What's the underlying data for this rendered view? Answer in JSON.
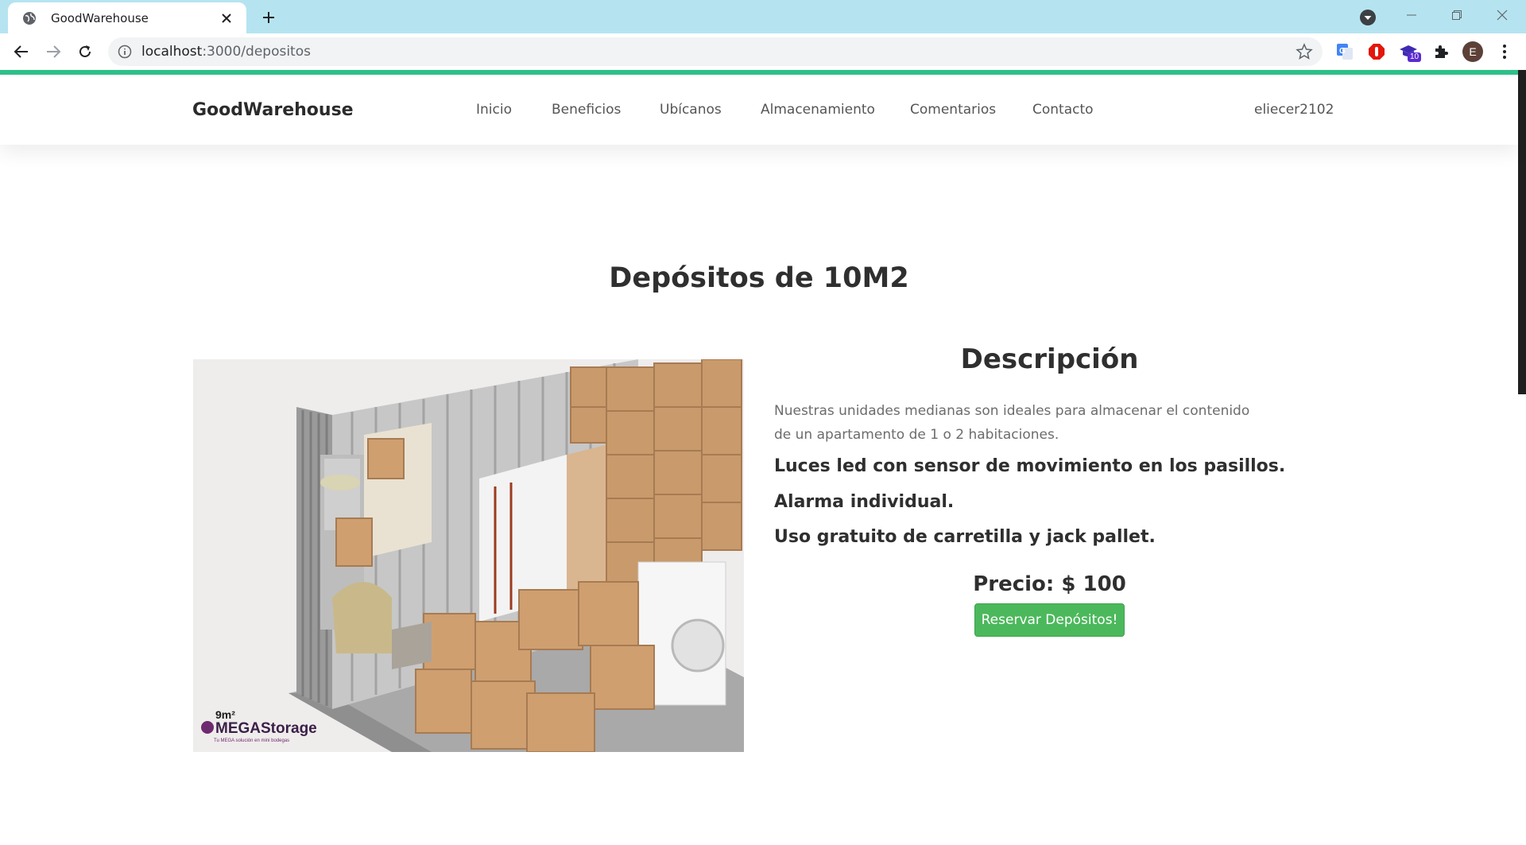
{
  "browser": {
    "tab_title": "GoodWarehouse",
    "url_host": "localhost",
    "url_path": ":3000/depositos",
    "extension_badge": "10",
    "profile_initial": "E"
  },
  "navbar": {
    "brand": "GoodWarehouse",
    "links": [
      "Inicio",
      "Beneficios",
      "Ubícanos",
      "Almacenamiento",
      "Comentarios",
      "Contacto"
    ],
    "user": "eliecer2102"
  },
  "main": {
    "title": "Depósitos de 10M2",
    "image_logo_size": "9m²",
    "image_logo_brand": "MEGAStorage",
    "image_logo_tagline": "Tu MEGA solución en mini bodegas",
    "description_heading": "Descripción",
    "description": "Nuestras unidades medianas son ideales para almacenar el contenido de un apartamento de 1 o 2 habitaciones.",
    "features": [
      "Luces led con sensor de movimiento en los pasillos.",
      "Alarma individual.",
      "Uso gratuito de carretilla y jack pallet."
    ],
    "price": "Precio: $ 100",
    "reserve_button": "Reservar Depósitos!"
  },
  "colors": {
    "tabbar": "#b5e4f0",
    "accent_bar": "#2ec28a",
    "button": "#4cb85c"
  }
}
